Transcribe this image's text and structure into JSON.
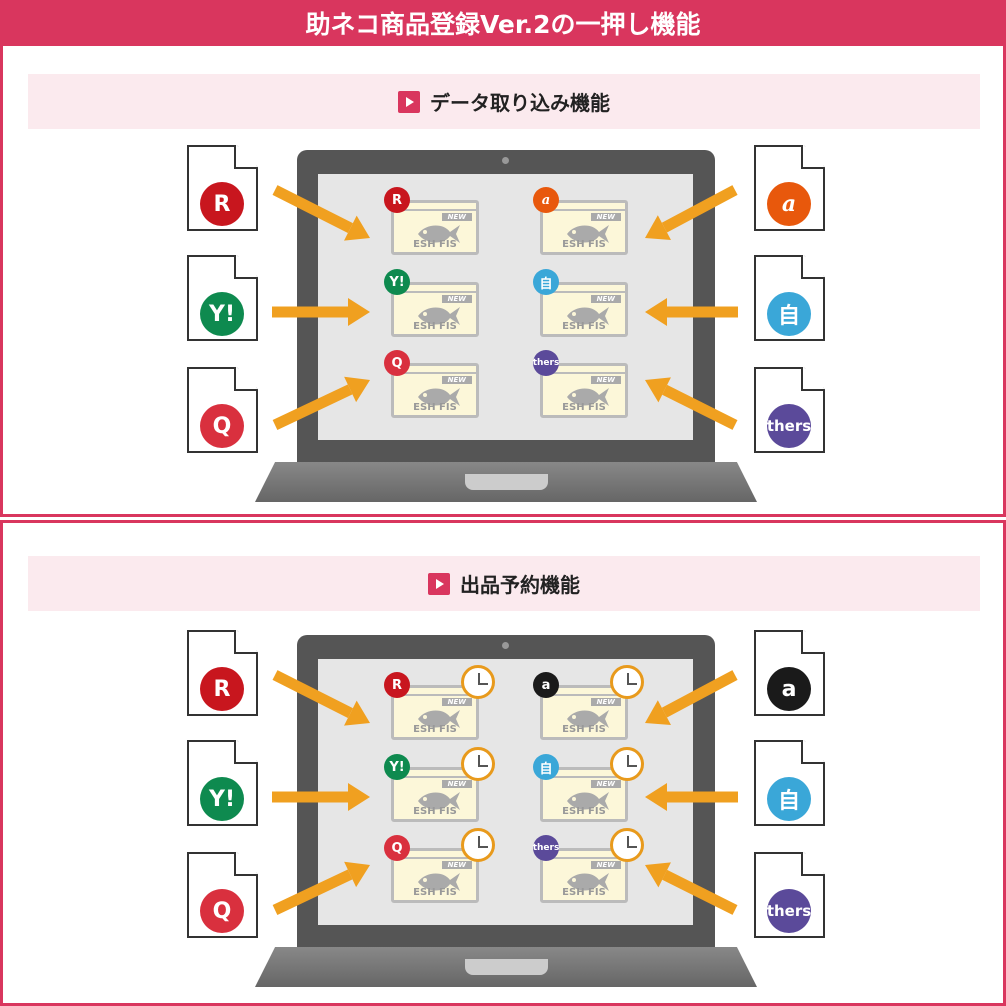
{
  "title": "助ネコ商品登録Ver.2の一押し機能",
  "card": {
    "new_label": "NEW",
    "text": "ESH FIS"
  },
  "colors": {
    "accent": "#d9365e",
    "arrow": "#f0a020",
    "clock_ring": "#e89a1c"
  },
  "panels": [
    {
      "heading": "データ取り込み機能",
      "has_clock": false,
      "left_sources": [
        {
          "label": "R",
          "color": "#c8161e"
        },
        {
          "label": "Y!",
          "color": "#0e8a4f"
        },
        {
          "label": "Q",
          "color": "#d9303e"
        }
      ],
      "right_sources": [
        {
          "label": "a",
          "color": "#e8580c",
          "italic": true
        },
        {
          "label": "自",
          "color": "#3aa7d8"
        },
        {
          "label": "thers",
          "color": "#5b4a9a"
        }
      ]
    },
    {
      "heading": "出品予約機能",
      "has_clock": true,
      "left_sources": [
        {
          "label": "R",
          "color": "#c8161e"
        },
        {
          "label": "Y!",
          "color": "#0e8a4f"
        },
        {
          "label": "Q",
          "color": "#d9303e"
        }
      ],
      "right_sources": [
        {
          "label": "a",
          "color": "#1a1a1a",
          "italic": false
        },
        {
          "label": "自",
          "color": "#3aa7d8"
        },
        {
          "label": "thers",
          "color": "#5b4a9a"
        }
      ]
    }
  ]
}
